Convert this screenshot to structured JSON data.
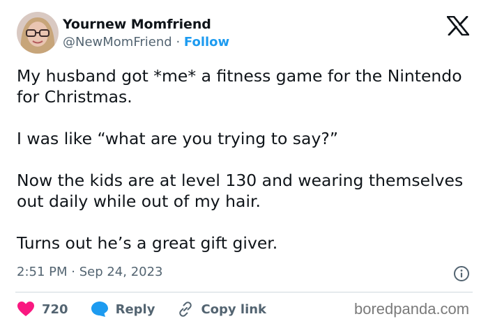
{
  "author": {
    "display_name": "Yournew Momfriend",
    "handle": "@NewMomFriend",
    "separator": "·",
    "follow_label": "Follow"
  },
  "tweet": {
    "paragraphs": [
      "My husband got *me* a fitness game for the Nintendo for Christmas.",
      "I was like “what are you trying to say?”",
      "Now the kids are at level 130 and wearing themselves out daily while out of my hair.",
      "Turns out he’s a great gift giver."
    ],
    "timestamp": "2:51 PM · Sep 24, 2023"
  },
  "actions": {
    "like_count": "720",
    "reply_label": "Reply",
    "copy_link_label": "Copy link"
  },
  "watermark": "boredpanda.com",
  "colors": {
    "like": "#f91880",
    "reply": "#1d9bf0",
    "link": "#1d9bf0",
    "muted": "#536471"
  },
  "icons": [
    "x-logo-icon",
    "info-icon",
    "heart-icon",
    "reply-bubble-icon",
    "link-icon"
  ]
}
